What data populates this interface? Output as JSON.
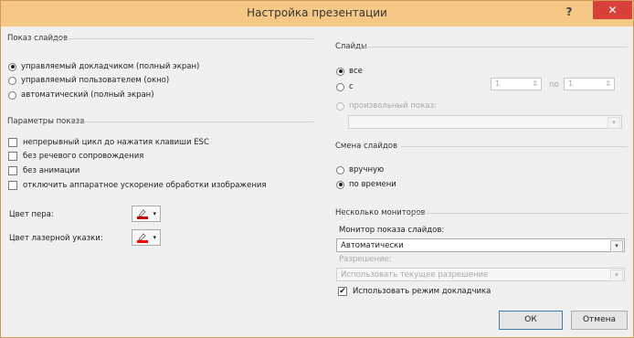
{
  "window": {
    "title": "Настройка презентации",
    "help": "?",
    "close": "✕"
  },
  "show_type": {
    "title": "Показ слайдов",
    "options": [
      {
        "label": "управляемый докладчиком (полный экран)",
        "selected": true
      },
      {
        "label": "управляемый пользователем (окно)",
        "selected": false
      },
      {
        "label": "автоматический (полный экран)",
        "selected": false
      }
    ]
  },
  "show_options": {
    "title": "Параметры показа",
    "checks": [
      {
        "label": "непрерывный цикл до нажатия клавиши ESC",
        "checked": false
      },
      {
        "label": "без речевого сопровождения",
        "checked": false
      },
      {
        "label": "без анимации",
        "checked": false
      },
      {
        "label": "отключить аппаратное ускорение обработки изображения",
        "checked": false
      }
    ],
    "pen_color_label": "Цвет пера:",
    "laser_color_label": "Цвет лазерной указки:",
    "pen_color": "#c00000",
    "laser_color": "#ff0000"
  },
  "slides": {
    "title": "Слайды",
    "all_label": "все",
    "from_label": "с",
    "from_value": "1",
    "to_label": "по",
    "to_value": "1",
    "custom_label": "произвольный показ:",
    "custom_value": ""
  },
  "advance": {
    "title": "Смена слайдов",
    "manual_label": "вручную",
    "timings_label": "по времени",
    "selected": "timings"
  },
  "monitors": {
    "title": "Несколько мониторов",
    "monitor_label": "Монитор показа слайдов:",
    "monitor_value": "Автоматически",
    "resolution_label": "Разрешение:",
    "resolution_value": "Использовать текущее разрешение",
    "presenter_view_label": "Использовать режим докладчика",
    "presenter_view_checked": true
  },
  "buttons": {
    "ok": "ОК",
    "cancel": "Отмена"
  },
  "icons": {
    "radio_dot": "●",
    "check_mark": "✔",
    "drop_arrow": "▾",
    "spin_arrow": "⇕"
  }
}
